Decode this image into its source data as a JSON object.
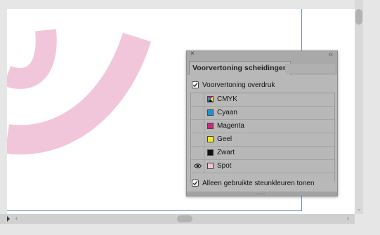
{
  "panel": {
    "close_icon": "×",
    "collapse_icon": "‹‹",
    "tab_label": "Voorvertoning scheidingen",
    "overprint_preview": {
      "label": "Voorvertoning overdruk",
      "checked": true
    },
    "separations": [
      {
        "name": "CMYK",
        "swatch": "cmyk-icon",
        "visible": false
      },
      {
        "name": "Cyaan",
        "swatch_color": "#1396d8",
        "visible": false
      },
      {
        "name": "Magenta",
        "swatch_color": "#d4237e",
        "visible": false
      },
      {
        "name": "Geel",
        "swatch_color": "#f6ea1a",
        "visible": false
      },
      {
        "name": "Zwart",
        "swatch_color": "#111111",
        "visible": false
      },
      {
        "name": "Spot",
        "swatch_color": "#f3c3d8",
        "visible": true
      }
    ],
    "used_inks_only": {
      "label": "Alleen gebruikte steunkleuren tonen",
      "checked": true
    }
  },
  "scrollbars": {
    "left_arrow": "‹",
    "right_arrow": "›",
    "down_arrow": "⌄"
  },
  "colors": {
    "artwork_pink": "#f1c6da",
    "guide_blue": "#6a83d6",
    "panel_bg": "#b8b8b8"
  }
}
